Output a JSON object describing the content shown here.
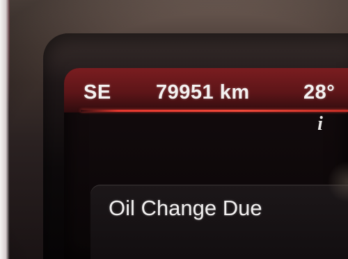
{
  "trip_display": {
    "compass_heading": "SE",
    "odometer": "79951 km",
    "outside_temperature": "28°",
    "info_icon_glyph": "i",
    "accent_color": "#e5382f"
  },
  "message": {
    "text": "Oil Change Due"
  },
  "icons": {
    "info": "info-icon"
  }
}
